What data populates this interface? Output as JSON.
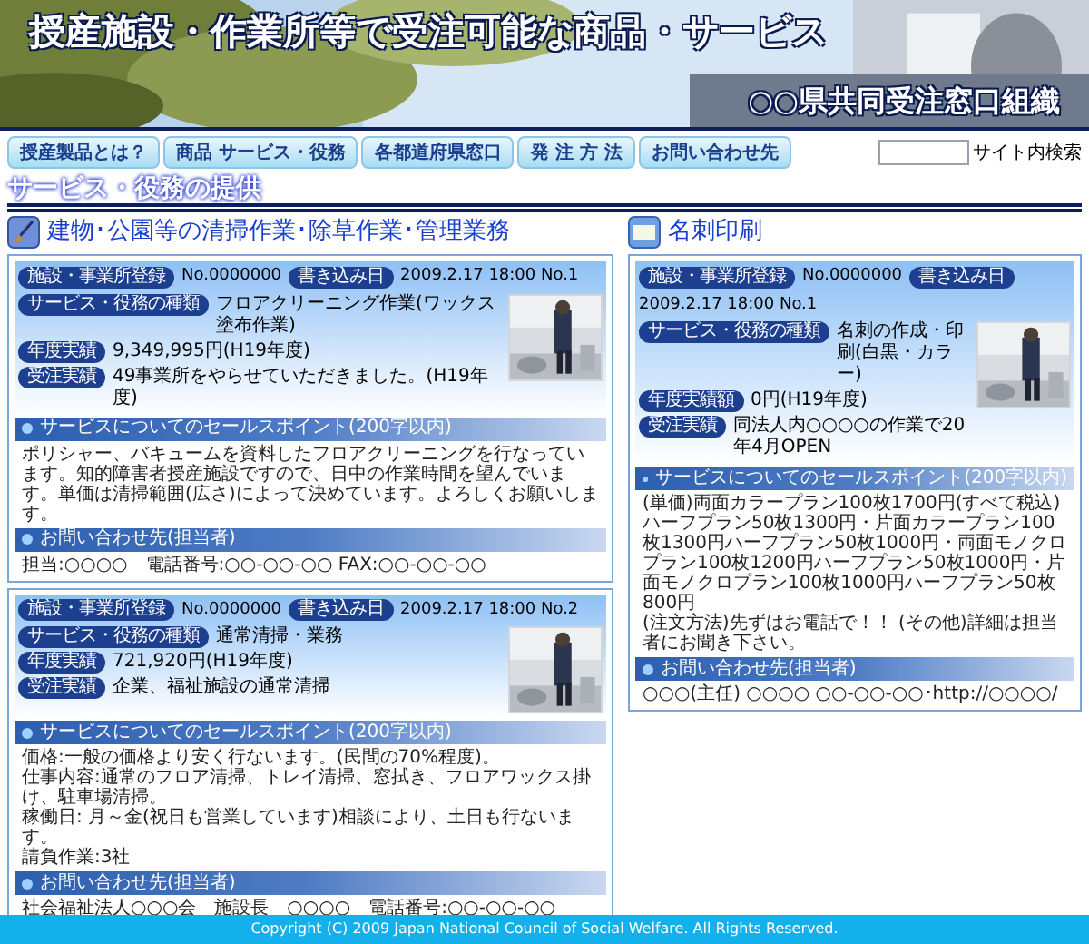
{
  "header": {
    "title": "授産施設・作業所等で受注可能な商品・サービス",
    "org": "○○県共同受注窓口組織"
  },
  "nav": [
    {
      "label": "授産製品とは？"
    },
    {
      "label": "商品 サービス・役務"
    },
    {
      "label": "各都道府県窓口"
    },
    {
      "label": "発 注 方 法"
    },
    {
      "label": "お問い合わせ先"
    }
  ],
  "search": {
    "button": "サイト内検索"
  },
  "section_title": "サービス・役務の提供",
  "columns": [
    {
      "category": {
        "title": "建物･公園等の清掃作業･除草作業･管理業務",
        "kind": "broom"
      },
      "cards": [
        {
          "reg_label": "施設・事業所登録",
          "reg_no": "No.0000000",
          "date_label": "書き込み日",
          "date": "2009.2.17 18:00 No.1",
          "rows": [
            {
              "label": "サービス・役務の種類",
              "value": "フロアクリーニング作業(ワックス塗布作業)"
            },
            {
              "label": "年度実績",
              "value": "9,349,995円(H19年度)"
            },
            {
              "label": "受注実績",
              "value": "49事業所をやらせていただきました。(H19年度)"
            }
          ],
          "sales_header": "サービスについてのセールスポイント(200字以内)",
          "sales_lines": [
            "ポリシャー、バキュームを資料したフロアクリーニングを行なっています。知的障害者授産施設ですので、日中の作業時間を望んでいます。単価は清掃範囲(広さ)によって決めています。よろしくお願いします。"
          ],
          "contact_header": "お問い合わせ先(担当者)",
          "contact": "担当:○○○○　電話番号:○○-○○-○○ FAX:○○-○○-○○"
        },
        {
          "reg_label": "施設・事業所登録",
          "reg_no": "No.0000000",
          "date_label": "書き込み日",
          "date": "2009.2.17 18:00 No.2",
          "rows": [
            {
              "label": "サービス・役務の種類",
              "value": "通常清掃・業務"
            },
            {
              "label": "年度実績",
              "value": "721,920円(H19年度)"
            },
            {
              "label": "受注実績",
              "value": "企業、福祉施設の通常清掃"
            }
          ],
          "sales_header": "サービスについてのセールスポイント(200字以内)",
          "sales_lines": [
            "価格:一般の価格より安く行ないます。(民間の70%程度)。",
            "仕事内容:通常のフロア清掃、トレイ清掃、窓拭き、フロアワックス掛け、駐車場清掃。",
            "稼働日: 月～金(祝日も営業しています)相談により、土日も行ないます。",
            "請負作業:3社"
          ],
          "contact_header": "お問い合わせ先(担当者)",
          "contact": "社会福祉法人○○○会　施設長　○○○○　電話番号:○○-○○-○○"
        }
      ]
    },
    {
      "category": {
        "title": "名刺印刷",
        "kind": "card"
      },
      "cards": [
        {
          "reg_label": "施設・事業所登録",
          "reg_no": "No.0000000",
          "date_label": "書き込み日",
          "date": "2009.2.17 18:00 No.1",
          "rows": [
            {
              "label": "サービス・役務の種類",
              "value": "名刺の作成・印刷(白黒・カラー)"
            },
            {
              "label": "年度実績額",
              "value": "0円(H19年度)"
            },
            {
              "label": "受注実績",
              "value": "同法人内○○○○の作業で20年4月OPEN"
            }
          ],
          "sales_header": "サービスについてのセールスポイント(200字以内)",
          "sales_lines": [
            "(単価)両面カラープラン100枚1700円(すべて税込)ハーフプラン50枚1300円・片面カラープラン100枚1300円ハーフプラン50枚1000円・両面モノクロプラン100枚1200円ハーフプラン50枚1000円・片面モノクロプラン100枚1000円ハーフプラン50枚800円",
            "(注文方法)先ずはお電話で！！ (その他)詳細は担当者にお聞き下さい。"
          ],
          "contact_header": "お問い合わせ先(担当者)",
          "contact": "○○○(主任) ○○○○ ○○-○○-○○･http://○○○○/"
        }
      ]
    }
  ],
  "footer": "Copyright (C) 2009 Japan National Council of Social Welfare. All Rights Reserved."
}
